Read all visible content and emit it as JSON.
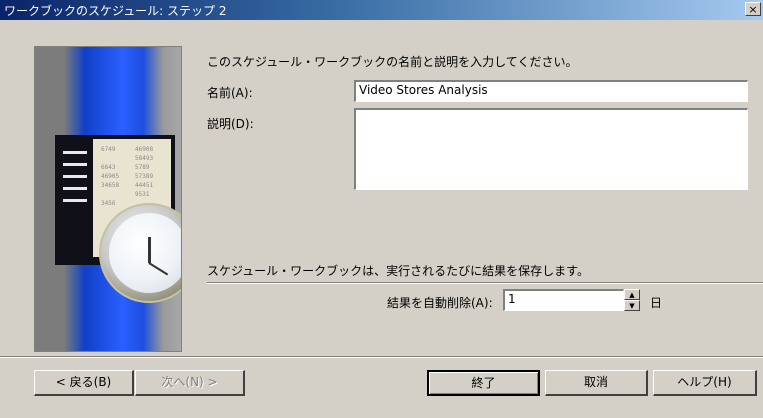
{
  "window": {
    "title": "ワークブックのスケジュール: ステップ 2",
    "close_glyph": "×"
  },
  "form": {
    "instruction": "このスケジュール・ワークブックの名前と説明を入力してください。",
    "name_label": "名前(A):",
    "name_value": "Video Stores Analysis",
    "description_label": "説明(D):",
    "description_value": "",
    "note": "スケジュール・ワークブックは、実行されるたびに結果を保存します。",
    "auto_delete_label": "結果を自動削除(A):",
    "auto_delete_value": "1",
    "auto_delete_unit": "日"
  },
  "illustration": {
    "doc_col1": "6749\n\n6643\n46905\n34658\n\n3456",
    "doc_col2": "46908\n58493\n5789\n57389\n44451\n9531"
  },
  "buttons": {
    "back": "< 戻る(B)",
    "next": "次へ(N) >",
    "finish": "終了",
    "cancel": "取消",
    "help": "ヘルプ(H)"
  },
  "icons": {
    "spin_up": "▲",
    "spin_down": "▼"
  }
}
